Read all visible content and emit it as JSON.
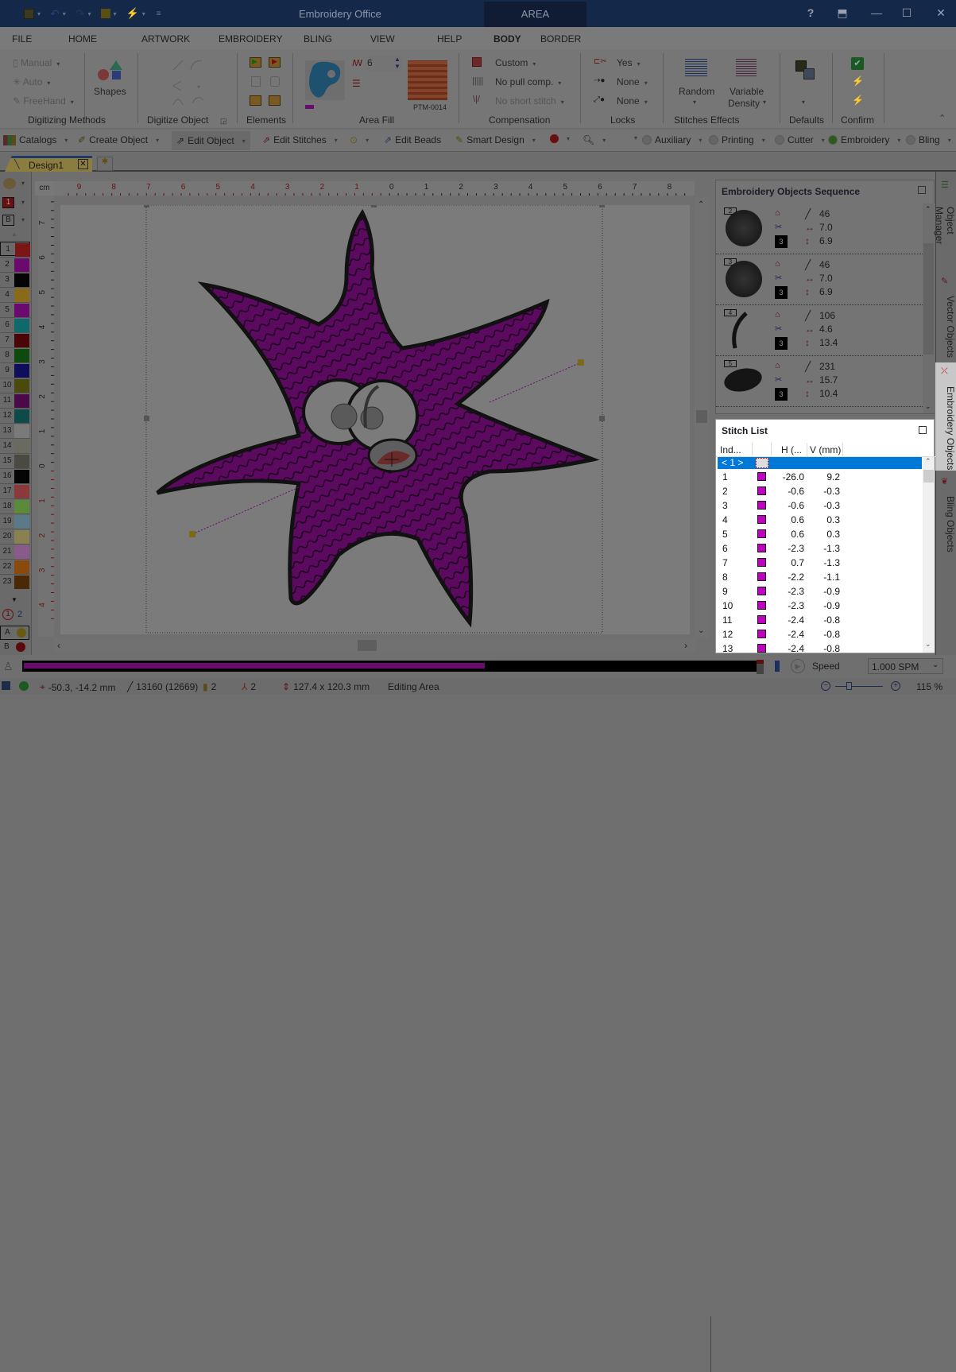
{
  "app": {
    "title": "Embroidery Office",
    "context_tab": "AREA"
  },
  "quick_access": [
    "save-icon",
    "undo-icon",
    "redo-icon",
    "paste-icon",
    "magic-icon",
    "customize-icon"
  ],
  "window_controls": {
    "help": "?",
    "restore_ribbon": "⬒",
    "minimize": "—",
    "maximize": "☐",
    "close": "✕"
  },
  "menu": [
    {
      "label": "FILE",
      "active": false
    },
    {
      "label": "HOME",
      "active": false
    },
    {
      "label": "ARTWORK",
      "active": false
    },
    {
      "label": "EMBROIDERY",
      "active": false
    },
    {
      "label": "BLING",
      "active": false
    },
    {
      "label": "VIEW",
      "active": false
    },
    {
      "label": "HELP",
      "active": false
    },
    {
      "label": "BODY",
      "active": true
    },
    {
      "label": "BORDER",
      "active": false
    }
  ],
  "ribbon": {
    "digitizing_methods": {
      "label": "Digitizing Methods",
      "items": [
        "Manual",
        "Auto",
        "FreeHand"
      ],
      "shapes": "Shapes"
    },
    "digitize_object": {
      "label": "Digitize Object"
    },
    "elements": {
      "label": "Elements"
    },
    "area_fill": {
      "label": "Area Fill",
      "density": "6",
      "pattern": "PTM-0014",
      "color": "#8a0e8e"
    },
    "compensation": {
      "label": "Compensation",
      "items": [
        "Custom",
        "No pull comp.",
        "No short stitch"
      ]
    },
    "locks": {
      "label": "Locks",
      "items": [
        "Yes",
        "None",
        "None"
      ]
    },
    "stitches_effects": {
      "label": "Stitches Effects",
      "random": "Random",
      "variable": "Variable",
      "density": "Density"
    },
    "defaults": {
      "label": "Defaults"
    },
    "confirm": {
      "label": "Confirm"
    }
  },
  "toolbar2": {
    "catalogs": "Catalogs",
    "create_object": "Create Object",
    "edit_object": "Edit Object",
    "edit_stitches": "Edit Stitches",
    "edit_beads": "Edit Beads",
    "smart_design": "Smart Design",
    "modes": [
      {
        "label": "Auxiliary",
        "on": false
      },
      {
        "label": "Printing",
        "on": false
      },
      {
        "label": "Cutter",
        "on": false
      },
      {
        "label": "Embroidery",
        "on": true
      },
      {
        "label": "Bling",
        "on": false
      }
    ]
  },
  "doc_tab": "Design1",
  "palette": {
    "current": "1",
    "background": "B",
    "colors": [
      {
        "n": "1",
        "c": "#7a1616"
      },
      {
        "n": "2",
        "c": "#6a0a6e"
      },
      {
        "n": "3",
        "c": "#050505"
      },
      {
        "n": "4",
        "c": "#8a6a18"
      },
      {
        "n": "5",
        "c": "#6a0a6e"
      },
      {
        "n": "6",
        "c": "#0e6a6a"
      },
      {
        "n": "7",
        "c": "#4a0606"
      },
      {
        "n": "8",
        "c": "#0e4a0e"
      },
      {
        "n": "9",
        "c": "#0e0e5a"
      },
      {
        "n": "10",
        "c": "#4a4a0e"
      },
      {
        "n": "11",
        "c": "#4a0a4a"
      },
      {
        "n": "12",
        "c": "#0e4a4a"
      },
      {
        "n": "13",
        "c": "#7a7a7a"
      },
      {
        "n": "14",
        "c": "#6a6a5e"
      },
      {
        "n": "15",
        "c": "#4a4a42"
      },
      {
        "n": "16",
        "c": "#050505"
      },
      {
        "n": "17",
        "c": "#8a3a3a"
      },
      {
        "n": "18",
        "c": "#5a8a3a"
      },
      {
        "n": "19",
        "c": "#5a7a8a"
      },
      {
        "n": "20",
        "c": "#8a8050"
      },
      {
        "n": "21",
        "c": "#8a5a8a"
      },
      {
        "n": "22",
        "c": "#8a4a0e"
      },
      {
        "n": "23",
        "c": "#4a2a06"
      }
    ],
    "needle_count": "2",
    "slot_a": "A",
    "slot_b": "B"
  },
  "ruler": {
    "unit": "cm",
    "h_neg": [
      "9",
      "8",
      "7",
      "6",
      "5",
      "4",
      "3",
      "2",
      "1"
    ],
    "h_pos": [
      "0",
      "1",
      "2",
      "3",
      "4",
      "5",
      "6",
      "7",
      "8"
    ],
    "v_pos": [
      "7",
      "6",
      "5",
      "4",
      "3",
      "2",
      "1",
      "0"
    ],
    "v_neg": [
      "1",
      "2",
      "3",
      "4"
    ]
  },
  "sequence_panel": {
    "title": "Embroidery Objects Sequence",
    "items": [
      {
        "index": "2",
        "needle": "3",
        "stitches": "46",
        "width": "7.0",
        "height": "6.9"
      },
      {
        "index": "3",
        "needle": "3",
        "stitches": "46",
        "width": "7.0",
        "height": "6.9"
      },
      {
        "index": "4",
        "needle": "3",
        "stitches": "106",
        "width": "4.6",
        "height": "13.4"
      },
      {
        "index": "5",
        "needle": "3",
        "stitches": "231",
        "width": "15.7",
        "height": "10.4"
      }
    ]
  },
  "stitch_list": {
    "title": "Stitch List",
    "columns": [
      "Ind...",
      "",
      "H (...",
      "V (mm)"
    ],
    "selected_row": "< 1 >",
    "swatch_color": "#c000c0",
    "rows": [
      {
        "i": "1",
        "h": "-26.0",
        "v": "9.2"
      },
      {
        "i": "2",
        "h": "-0.6",
        "v": "-0.3"
      },
      {
        "i": "3",
        "h": "-0.6",
        "v": "-0.3"
      },
      {
        "i": "4",
        "h": "0.6",
        "v": "0.3"
      },
      {
        "i": "5",
        "h": "0.6",
        "v": "0.3"
      },
      {
        "i": "6",
        "h": "-2.3",
        "v": "-1.3"
      },
      {
        "i": "7",
        "h": "0.7",
        "v": "-1.3"
      },
      {
        "i": "8",
        "h": "-2.2",
        "v": "-1.1"
      },
      {
        "i": "9",
        "h": "-2.3",
        "v": "-0.9"
      },
      {
        "i": "10",
        "h": "-2.3",
        "v": "-0.9"
      },
      {
        "i": "11",
        "h": "-2.4",
        "v": "-0.8"
      },
      {
        "i": "12",
        "h": "-2.4",
        "v": "-0.8"
      },
      {
        "i": "13",
        "h": "-2.4",
        "v": "-0.8"
      }
    ]
  },
  "side_tabs": [
    "Object Manager",
    "Vector Objects",
    "Embroidery Objects",
    "Bling Objects"
  ],
  "simulation": {
    "progress_fraction": 0.63,
    "speed_label": "Speed",
    "speed_value": "1.000 SPM"
  },
  "status": {
    "coords": "-50.3, -14.2 mm",
    "stitches": "13160 (12669)",
    "colors": "2",
    "trims": "2",
    "size": "127.4 x 120.3 mm",
    "mode": "Editing Area",
    "zoom": "115 %"
  }
}
